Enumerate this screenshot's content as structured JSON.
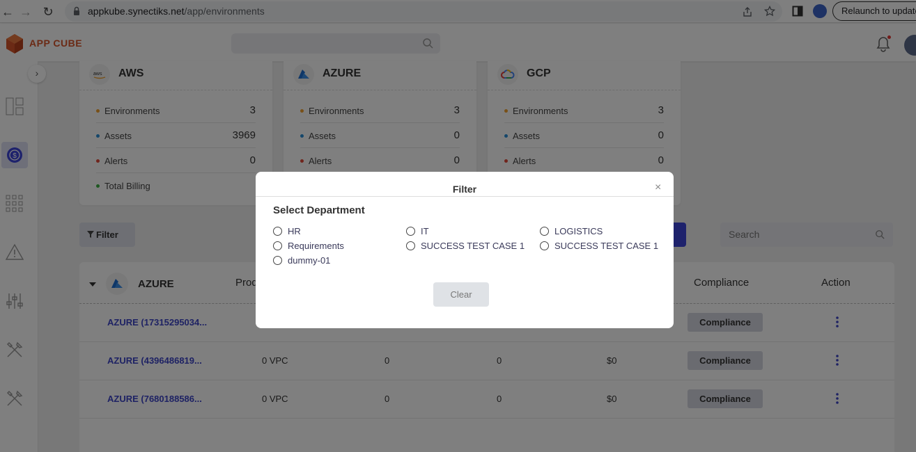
{
  "browser": {
    "url_host": "appkube.synectiks.net",
    "url_path": "/app/environments",
    "relaunch_label": "Relaunch to update"
  },
  "app": {
    "logo_text": "APP CUBE"
  },
  "clouds": [
    {
      "name": "AWS",
      "stats": [
        {
          "label": "Environments",
          "value": "3",
          "color": "#f0a030"
        },
        {
          "label": "Assets",
          "value": "3969",
          "color": "#2a8fd6"
        },
        {
          "label": "Alerts",
          "value": "0",
          "color": "#e04b3a"
        },
        {
          "label": "Total Billing",
          "value": "",
          "color": "#3cb043"
        }
      ]
    },
    {
      "name": "AZURE",
      "stats": [
        {
          "label": "Environments",
          "value": "3",
          "color": "#f0a030"
        },
        {
          "label": "Assets",
          "value": "0",
          "color": "#2a8fd6"
        },
        {
          "label": "Alerts",
          "value": "0",
          "color": "#e04b3a"
        }
      ]
    },
    {
      "name": "GCP",
      "stats": [
        {
          "label": "Environments",
          "value": "3",
          "color": "#f0a030"
        },
        {
          "label": "Assets",
          "value": "0",
          "color": "#2a8fd6"
        },
        {
          "label": "Alerts",
          "value": "0",
          "color": "#e04b3a"
        }
      ]
    }
  ],
  "toolbar": {
    "filter_label": "Filter",
    "search_placeholder": "Search"
  },
  "table": {
    "group_name": "AZURE",
    "headers": {
      "products": "Prod",
      "compliance": "Compliance",
      "action": "Action"
    },
    "rows": [
      {
        "name": "AZURE (17315295034...",
        "products": "",
        "c1": "",
        "c2": "",
        "billing": "",
        "compliance": "Compliance"
      },
      {
        "name": "AZURE (4396486819...",
        "products": "0 VPC",
        "c1": "0",
        "c2": "0",
        "billing": "$0",
        "compliance": "Compliance"
      },
      {
        "name": "AZURE (7680188586...",
        "products": "0 VPC",
        "c1": "0",
        "c2": "0",
        "billing": "$0",
        "compliance": "Compliance"
      }
    ]
  },
  "modal": {
    "title": "Filter",
    "close": "×",
    "heading": "Select Department",
    "options": [
      "HR",
      "IT",
      "LOGISTICS",
      "Requirements",
      "SUCCESS TEST CASE 1",
      "SUCCESS TEST CASE 1",
      "dummy-01"
    ],
    "clear_label": "Clear"
  }
}
